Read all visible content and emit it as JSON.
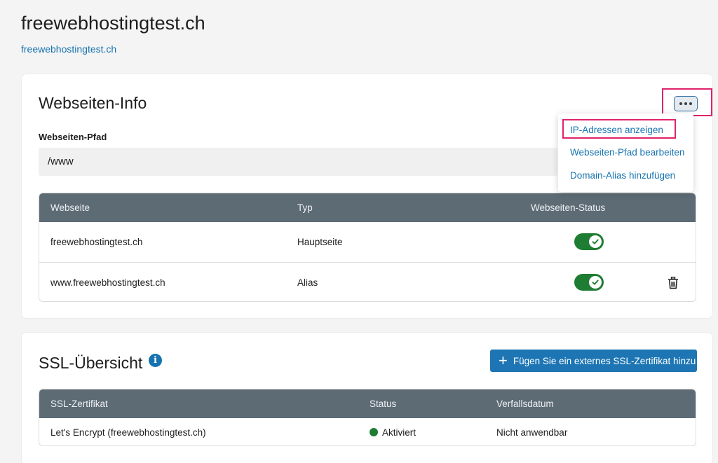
{
  "header": {
    "title": "freewebhostingtest.ch",
    "domain_link": "freewebhostingtest.ch"
  },
  "info_card": {
    "title": "Webseiten-Info",
    "more_icon": "ellipsis-icon",
    "path_label": "Webseiten-Pfad",
    "path_value": "/www",
    "menu": {
      "items": [
        {
          "label": "IP-Adressen anzeigen"
        },
        {
          "label": "Webseiten-Pfad bearbeiten"
        },
        {
          "label": "Domain-Alias hinzufügen"
        }
      ]
    },
    "table": {
      "headers": [
        "Webseite",
        "Typ",
        "Webseiten-Status"
      ],
      "rows": [
        {
          "website": "freewebhostingtest.ch",
          "type": "Hauptseite",
          "status_on": true,
          "deletable": false
        },
        {
          "website": "www.freewebhostingtest.ch",
          "type": "Alias",
          "status_on": true,
          "deletable": true
        }
      ]
    }
  },
  "ssl_card": {
    "title": "SSL-Übersicht",
    "info_icon": "info-icon",
    "add_button": "Fügen Sie ein externes SSL-Zertifikat hinzu",
    "table": {
      "headers": [
        "SSL-Zertifikat",
        "Status",
        "Verfallsdatum"
      ],
      "rows": [
        {
          "certificate": "Let's Encrypt (freewebhostingtest.ch)",
          "status": "Aktiviert",
          "expiry": "Nicht anwendbar"
        }
      ]
    }
  },
  "colors": {
    "accent": "#1673b0",
    "highlight": "#e0236b",
    "table_header": "#5d6b75",
    "success": "#1e7d32"
  }
}
